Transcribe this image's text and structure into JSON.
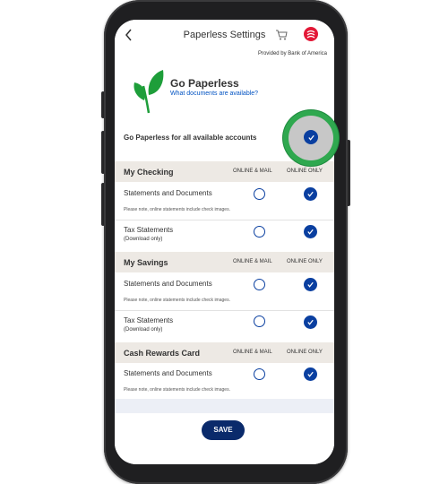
{
  "nav": {
    "title": "Paperless Settings",
    "provided_by": "Provided by Bank of America"
  },
  "header": {
    "title": "Go Paperless",
    "link": "What documents are available?"
  },
  "all_accounts": {
    "label": "Go Paperless for all available accounts",
    "checked": true
  },
  "columns": {
    "online_mail": "ONLINE & MAIL",
    "online_only": "ONLINE ONLY"
  },
  "sections": [
    {
      "title": "My Checking",
      "rows": [
        {
          "label": "Statements and Documents",
          "note": "Please note, online statements include check images.",
          "selection": "online_only"
        },
        {
          "label": "Tax Statements",
          "sub": "(Download only)",
          "selection": "online_only"
        }
      ]
    },
    {
      "title": "My Savings",
      "rows": [
        {
          "label": "Statements and Documents",
          "note": "Please note, online statements include check images.",
          "selection": "online_only"
        },
        {
          "label": "Tax Statements",
          "sub": "(Download only)",
          "selection": "online_only"
        }
      ]
    },
    {
      "title": "Cash Rewards Card",
      "rows": [
        {
          "label": "Statements and Documents",
          "note": "Please note, online statements include check images.",
          "selection": "online_only"
        }
      ]
    }
  ],
  "save_label": "SAVE",
  "colors": {
    "accent": "#0a3fa0",
    "save": "#0a2a6b",
    "highlight": "#2fa84f",
    "brand": "#e31837",
    "leaf": "#1e9e3a"
  },
  "icons": {
    "back": "chevron-left-icon",
    "cart": "cart-icon",
    "brand": "bank-of-america-logo-icon",
    "leaf": "leaf-icon",
    "check": "check-icon"
  }
}
